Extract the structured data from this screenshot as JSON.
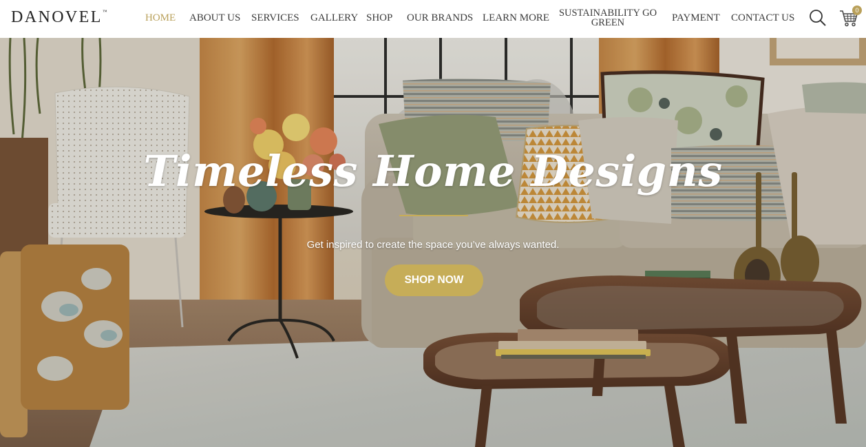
{
  "header": {
    "logo": "DANOVEL",
    "logo_tm": "™",
    "nav": [
      {
        "label": "HOME",
        "active": true
      },
      {
        "label": "ABOUT US"
      },
      {
        "label": "SERVICES"
      },
      {
        "label": "GALLERY"
      },
      {
        "label": "SHOP"
      },
      {
        "label": "OUR BRANDS"
      },
      {
        "label": "LEARN MORE"
      },
      {
        "label": "SUSTAINABILITY GO GREEN"
      },
      {
        "label": "PAYMENT"
      },
      {
        "label": "CONTACT US"
      }
    ],
    "search_icon": "search-icon",
    "cart_icon": "cart-icon",
    "cart_count": "0"
  },
  "hero": {
    "title": "Timeless Home Designs",
    "subtitle": "Get inspired to create the space you’ve always wanted.",
    "cta_label": "SHOP NOW"
  },
  "colors": {
    "accent": "#c6ad58",
    "nav_active": "#b9a05a",
    "nav_text": "#3a3a3a"
  }
}
